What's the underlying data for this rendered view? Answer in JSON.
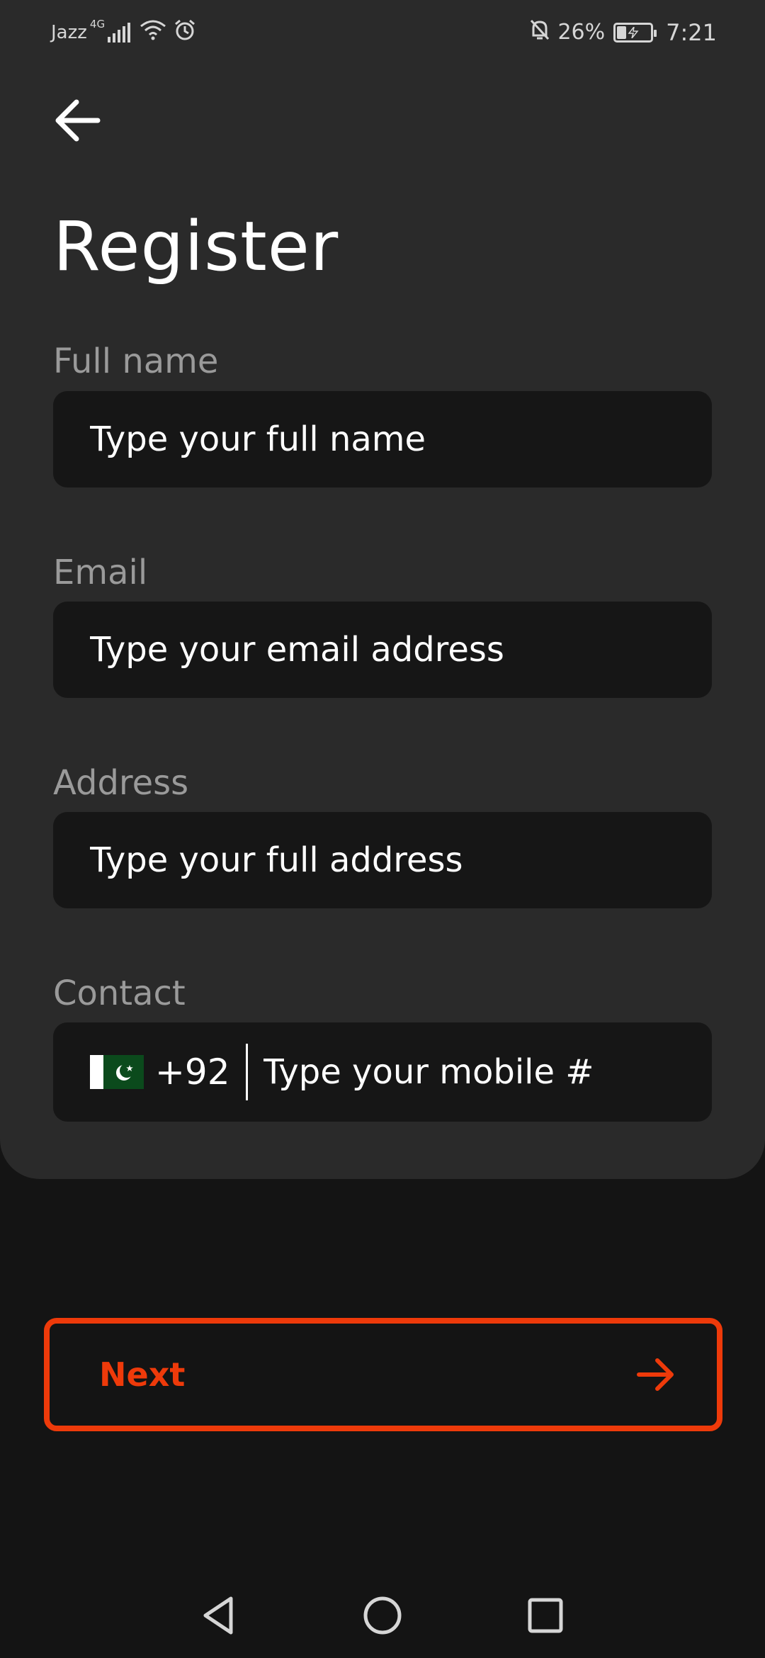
{
  "status_bar": {
    "carrier": "Jazz",
    "network_type": "4G",
    "battery_percent": "26%",
    "battery_level": 0.26,
    "time": "7:21",
    "icons": [
      "signal-icon",
      "wifi-icon",
      "alarm-icon",
      "notifications-off-icon",
      "battery-charging-icon"
    ]
  },
  "header": {
    "back_icon": "arrow-left-icon",
    "title": "Register"
  },
  "form": {
    "full_name": {
      "label": "Full name",
      "placeholder": "Type your full name",
      "value": ""
    },
    "email": {
      "label": "Email",
      "placeholder": "Type your email address",
      "value": ""
    },
    "address": {
      "label": "Address",
      "placeholder": "Type your full address",
      "value": ""
    },
    "contact": {
      "label": "Contact",
      "country_flag": "pakistan-flag-icon",
      "country_code": "+92",
      "placeholder": "Type your mobile #",
      "value": ""
    }
  },
  "actions": {
    "next_label": "Next",
    "next_icon": "arrow-right-icon",
    "accent_color": "#ee3a0a"
  },
  "nav_bar": {
    "buttons": [
      "back-triangle-icon",
      "home-circle-icon",
      "recents-square-icon"
    ]
  },
  "colors": {
    "background": "#141414",
    "card": "#2a2a2a",
    "field": "#161616",
    "label": "#9a9a9a"
  }
}
